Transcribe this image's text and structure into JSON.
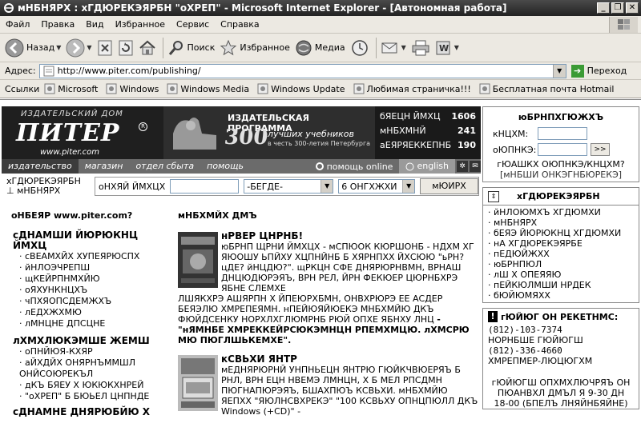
{
  "window": {
    "title": "мНБНЯРХ : хГДЮРЕКЭЯРБН \"оХРЕП\" - Microsoft Internet Explorer - [Автономная работа]"
  },
  "menu": [
    "Файл",
    "Правка",
    "Вид",
    "Избранное",
    "Сервис",
    "Справка"
  ],
  "toolbar": {
    "back": "Назад",
    "search": "Поиск",
    "favorites": "Избранное",
    "media": "Медиа"
  },
  "address": {
    "label": "Адрес:",
    "url": "http://www.piter.com/publishing/",
    "go": "Переход"
  },
  "links": {
    "label": "Ссылки",
    "items": [
      "Microsoft",
      "Windows",
      "Windows Media",
      "Windows Update",
      "Любимая страничка!!!",
      "Бесплатная почта Hotmail"
    ]
  },
  "banner": {
    "publisher": "ИЗДАТЕЛЬСКИЙ ДОМ",
    "logo": "ПИТЕР",
    "reg": "R",
    "www": "www.piter.com",
    "promo_title": "ИЗДАТЕЛЬСКАЯ ПРОГРАММА",
    "promo_number": "300",
    "promo_sub": "лучших учебников",
    "promo_sub2": "в честь 300-летия Петербурга",
    "stats": [
      {
        "label": "бЯЕЦН ЙМХЦ",
        "value": "1606"
      },
      {
        "label": "мНБХМНЙ",
        "value": "241"
      },
      {
        "label": "аЕЯРЯЕККЕПНБ",
        "value": "190"
      }
    ]
  },
  "nav": {
    "tabs": [
      "издательство",
      "магазин",
      "отдел сбыта",
      "помощь"
    ],
    "help": "помощь online",
    "english": "english"
  },
  "search": {
    "left_label_1": "хГДЮРЕКЭЯРБН",
    "left_label_2": "мНБНЯРХ",
    "label": "оНХЯЙ ЙМХЦХ",
    "select1": "-БЕГДЕ-",
    "select2": "6 ОНГХЖХИ",
    "button": "мЮИРХ"
  },
  "left": {
    "heading": "оНБЕЯР www.piter.com?",
    "sections": [
      {
        "title": "сДНАМШИ ЙЮРЮКНЦ ЙМХЦ",
        "items": [
          "сВЕАМХЙХ ХУПЕЯРЮСПХ",
          "йНЛОЭЧРЕПШ",
          "щКЕЙРПНМХЙЮ",
          "оЯХУНКНЦХЪ",
          "чПХЯОПСДЕМЖХЪ",
          "лЕДХЖХМЮ",
          "лМНЦНЕ ДПСЦНЕ"
        ]
      },
      {
        "title": "лХМХЛЮКЭМШЕ ЖЕМШ",
        "items": [
          "оПНЙЮЯ-КХЯР",
          "аЙХДЙХ ОНЯРНЪММШЛ ОНЙСОЮРЕКЪЛ",
          "дКЪ БЯЕУ Х ЮКЮКХНРЕЙ",
          "\"оХРЕП\" Б БЮЬЕЛ ЦНПНДЕ"
        ]
      },
      {
        "title": "сДНАМНЕ ДНЯРЮБЙЮ Х",
        "items": []
      }
    ]
  },
  "center": {
    "heading": "мНБХМЙХ ДМЪ",
    "books": [
      {
        "title": "нРВЕР ЦНРНБ!",
        "desc": "юБРНП ЩРНИ ЙМХЦХ - мСПЮОК КЮРШОНБ - НДХМ ХГ ЯЮОШУ ЬПЙХУ ХЦПНЙНБ Б ХЯРНПХХ ЙХСЮЮ \"ьРН? цДЕ? йНЦДЮ?\". щРКЦН СФЕ ДНЯРЮРНВМН, ВРНАШ ДНЦЮДЮРЭЯЪ, ВРН РЕЛ, ЙРН ФЕКЮЕР ЦЮРНБХРЭ ЯБНЕ СЛЕМХЕ",
        "desc2": "ЛШЯКХРЭ АШЯРПН Х ЙПЕЮРХБМН, ОНВХРЮРЭ ЕЕ АСДЕР БЕЯЭЛЮ ХМРЕПЕЯМН. нПЕЙЮЯЙЮЕКЭ МНБХМЙЮ ДКЪ ФЮЙДСЕНКУ НОРХЛХГЛЮМРНБ РЮЙ ОПХЕ ЯБНХУ ЛНЦ ",
        "desc2_bold": "- \"нЯМНБЕ ХМРЕККЕЙРСЮКЭМНЦН РПЕМХМЦЮ. лХМСРЮ МЮ ПЮГЛШЬКЕМХЕ\"."
      },
      {
        "title": "кСВЬХИ ЯНТР",
        "desc": "мЕДНЯРЮРНЙ УНПНЬЕЦН ЯНТРЮ ГЮЙКЧВЮЕРЯЪ Б РНЛ, ВРН ЕЦН НВЕМЭ ЛМНЦН, Х Б МЕЛ РПСДМН ПЮГНАПЮРЭЯЪ, БШАХПЮЪ КСВЬХИ. мНБХМЙЮ ЯЕПХХ \"ЯЮЛНСВХРЕКЭ\" \"100 КСВЬХУ ОПНЦПЮЛЛ ДКЪ Windows (+CD)\" - "
      }
    ]
  },
  "login": {
    "title": "юБРНПХГЮЖХЪ",
    "login_label": "кНЦХМ:",
    "password_label": "оЮПНКЭ:",
    "go": ">>",
    "forgot": "гЮАШКХ ОЮПНКЭ/КНЦХМ?",
    "register": "[мНБШИ ОНКЭГНБЮРЕКЭ]"
  },
  "publisher_menu": {
    "title": "хГДЮРЕКЭЯРБН",
    "items": [
      "йНЛОЮМХЪ ХГДЮМХИ",
      "мНБНЯРХ",
      "бЕЯЭ ЙЮРЮКНЦ ХГДЮМХИ",
      "нА ХГДЮРЕКЭЯРБЕ",
      "пЕДЮЙЖХХ",
      "юБРНПЮЛ",
      "лШ Х ОПЕЯЯЮ",
      "пЕЙКЮЛМШИ НРДЕК",
      "бЮЙЮМЯХХ"
    ]
  },
  "contact": {
    "title": "гЮЙЮГ ОН РЕКЕТНМС:",
    "phone1": "(812)-103-7374",
    "line1": "НОРНБШЕ ГЮЙЮГШ",
    "phone2": "(812)-336-4660",
    "line2": "ХМРЕПМЕР-ЛЮЦЮГХМ",
    "p1": "гЮЙЮГШ ОПХМХЛЮЧРЯЪ ОН",
    "p2": "ПЮАНВХЛ ДМЪЛ Я 9-30 ДН",
    "p3": "18-00 (БПЕЛЪ ЛНЯЙНБЯЙНЕ)"
  }
}
